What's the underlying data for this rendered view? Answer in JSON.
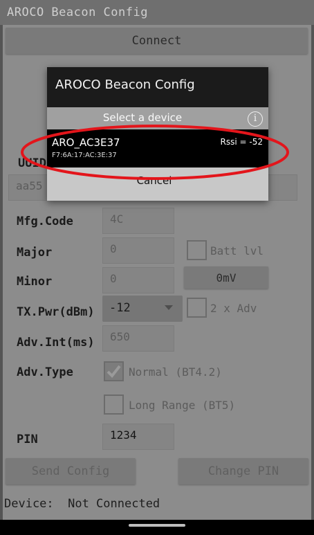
{
  "app": {
    "title": "AROCO Beacon Config",
    "connect_label": "Connect",
    "uuid_label": "UUID",
    "uuid_value": "aa55",
    "mfg_code_label": "Mfg.Code",
    "mfg_code_value": "4C",
    "major_label": "Major",
    "major_value": "0",
    "minor_label": "Minor",
    "minor_value": "0",
    "batt_lvl_label": "Batt lvl",
    "batt_button_label": "0mV",
    "tx_pwr_label": "TX.Pwr(dBm)",
    "tx_pwr_value": "-12",
    "two_x_adv_label": "2 x Adv",
    "adv_int_label": "Adv.Int(ms)",
    "adv_int_value": "650",
    "adv_type_label": "Adv.Type",
    "normal_label": "Normal (BT4.2)",
    "long_range_label": "Long Range (BT5)",
    "pin_label": "PIN",
    "pin_value": "1234",
    "send_config_label": "Send Config",
    "change_pin_label": "Change PIN",
    "status_text": "Device:  Not Connected"
  },
  "dialog": {
    "title": "AROCO Beacon Config",
    "subtitle": "Select a device",
    "device": {
      "name": "ARO_AC3E37",
      "mac": "F7:6A:17:AC:3E:37",
      "rssi": "Rssi = -52"
    },
    "cancel_label": "Cancel"
  },
  "colors": {
    "highlight": "#e3151b",
    "overlay": "#555555",
    "dialog_bg": "#1b1b1b"
  },
  "icons": [
    "info-icon",
    "checkbox-checked-icon",
    "dropdown-caret-icon"
  ]
}
